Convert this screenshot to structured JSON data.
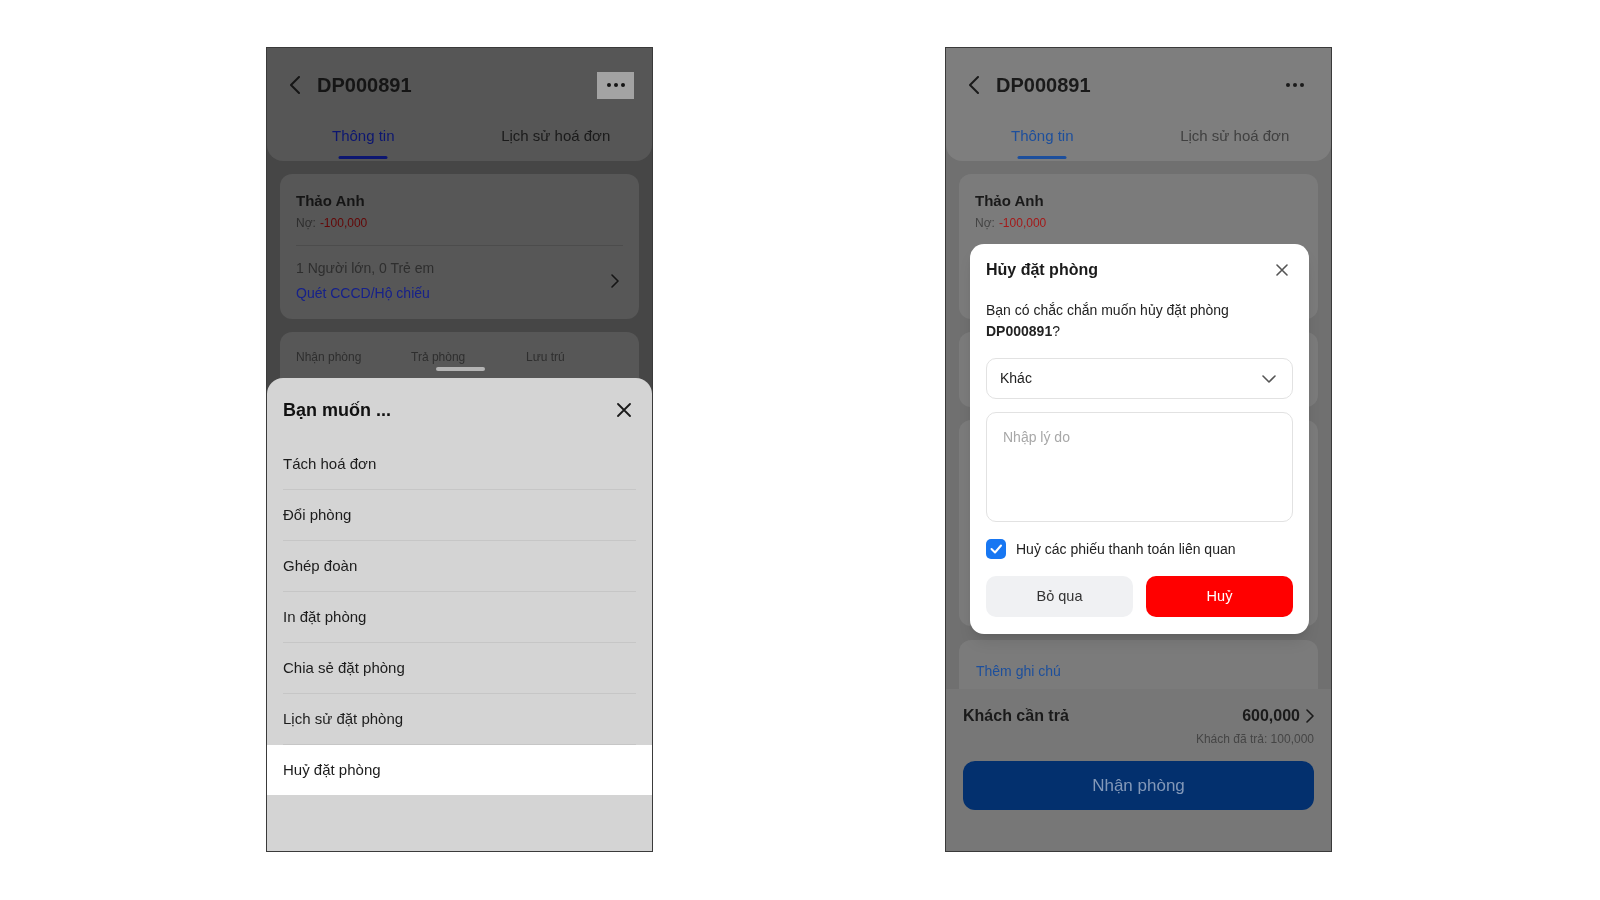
{
  "screens": [
    {
      "kind": "action_sheet",
      "header": {
        "title": "DP000891",
        "more_pressed": true
      },
      "tabs": [
        {
          "label": "Thông tin",
          "selected": true
        },
        {
          "label": "Lịch sử hoá đơn",
          "selected": false
        }
      ],
      "guest_card": {
        "name": "Thảo Anh",
        "debt_label": "Nợ:",
        "debt_value": "-100,000",
        "guests": "1 Người lớn, 0 Trẻ em",
        "scan_link": "Quét CCCD/Hộ chiếu"
      },
      "stay_card": {
        "labels": [
          "Nhận phòng",
          "Trả phòng",
          "Lưu trú"
        ]
      },
      "sheet": {
        "title": "Bạn muốn ...",
        "items": [
          {
            "label": "Tách hoá đơn",
            "selected": false
          },
          {
            "label": "Đổi phòng",
            "selected": false
          },
          {
            "label": "Ghép đoàn",
            "selected": false
          },
          {
            "label": "In đặt phòng",
            "selected": false
          },
          {
            "label": "Chia sẻ đặt phòng",
            "selected": false
          },
          {
            "label": "Lịch sử đặt phòng",
            "selected": false
          },
          {
            "label": "Huỷ đặt phòng",
            "selected": true
          }
        ]
      }
    },
    {
      "kind": "cancel_dialog",
      "header": {
        "title": "DP000891",
        "more_pressed": false
      },
      "tabs": [
        {
          "label": "Thông tin",
          "selected": true
        },
        {
          "label": "Lịch sử hoá đơn",
          "selected": false
        }
      ],
      "guest_card": {
        "name": "Thảo Anh",
        "debt_label": "Nợ:",
        "debt_value": "-100,000"
      },
      "note_link": "Thêm ghi chú",
      "footer": {
        "total_label": "Khách cần trả",
        "total_value": "600,000",
        "paid": "Khách đã trả: 100,000",
        "button": "Nhận phòng"
      },
      "dialog": {
        "title": "Hủy đặt phòng",
        "message": "Bạn có chắc chắn muốn hủy đặt phòng **DP000891**?",
        "select": {
          "value": "Khác"
        },
        "reason": {
          "placeholder": "Nhập lý do"
        },
        "checkbox": {
          "label": "Huỷ các phiếu thanh toán liên quan",
          "checked": true
        },
        "buttons": [
          {
            "label": "Bỏ qua",
            "kind": "secondary"
          },
          {
            "label": "Huỷ",
            "kind": "danger"
          }
        ]
      }
    }
  ]
}
